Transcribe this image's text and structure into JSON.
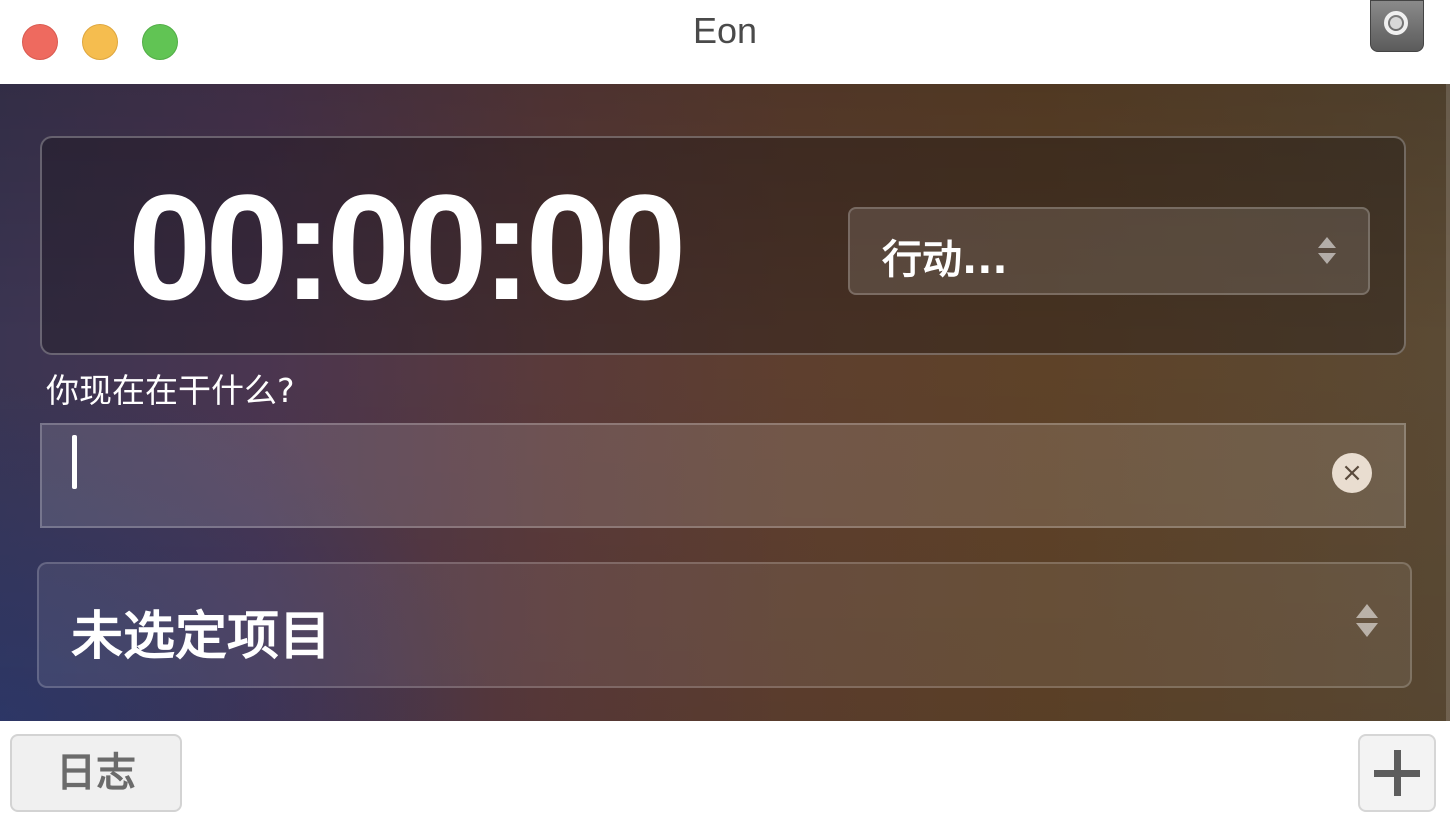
{
  "window": {
    "title": "Eon"
  },
  "timer": {
    "display": "00:00:00"
  },
  "action_select": {
    "value": "行动..."
  },
  "activity": {
    "prompt": "你现在在干什么?",
    "value": "",
    "clear_icon": "×"
  },
  "project_select": {
    "value": "未选定项目"
  },
  "footer": {
    "log_label": "日志",
    "add_icon": "plus-icon"
  },
  "colors": {
    "close": "#ee6a5f",
    "minimize": "#f5bd4f",
    "zoom": "#61c454"
  }
}
